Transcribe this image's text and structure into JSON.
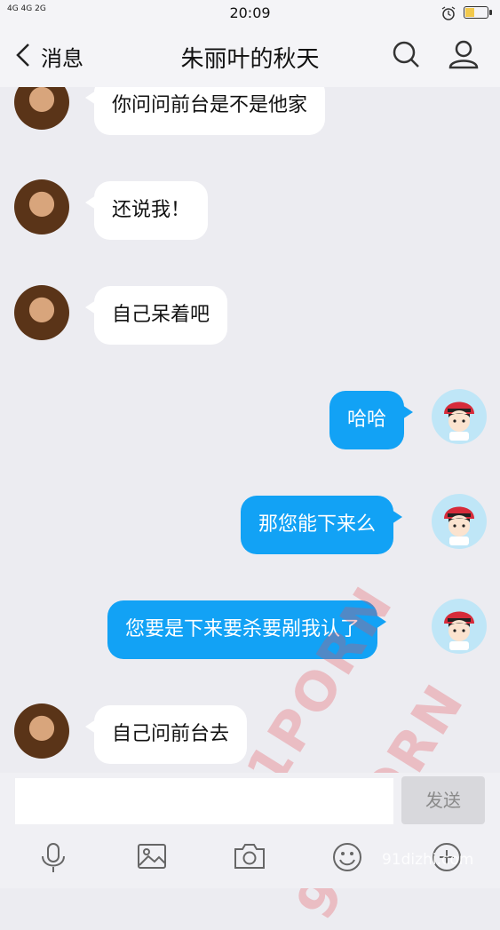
{
  "status_bar": {
    "signal": "4G 4G 2G",
    "time": "20:09"
  },
  "header": {
    "back_label": "消息",
    "title": "朱丽叶的秋天"
  },
  "messages": [
    {
      "side": "left",
      "text": "你问问前台是不是他家"
    },
    {
      "side": "left",
      "text": "还说我！"
    },
    {
      "side": "left",
      "text": "自己呆着吧"
    },
    {
      "side": "right",
      "text": "哈哈"
    },
    {
      "side": "right",
      "text": "那您能下来么"
    },
    {
      "side": "right",
      "text": "您要是下来要杀要剐我认了"
    },
    {
      "side": "left",
      "text": "自己问前台去"
    }
  ],
  "input": {
    "value": "",
    "send_label": "发送"
  },
  "toolbar": [
    "microphone-icon",
    "image-icon",
    "camera-icon",
    "emoji-icon",
    "more-icon"
  ],
  "watermark": {
    "text": "91PORN",
    "site": "91dizhi.com"
  },
  "colors": {
    "sent_bubble": "#12a2f5",
    "received_bubble": "#ffffff",
    "background": "#ececf1"
  }
}
